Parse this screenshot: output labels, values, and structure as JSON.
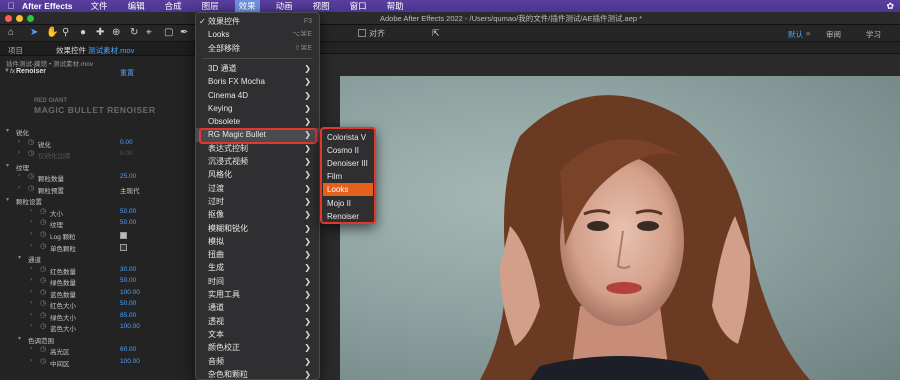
{
  "menubar": {
    "app_name": "After Effects",
    "items": [
      "文件",
      "编辑",
      "合成",
      "图层",
      "效果",
      "动画",
      "视图",
      "窗口",
      "帮助"
    ],
    "active_item": "效果"
  },
  "window": {
    "title": "Adobe After Effects 2022 - /Users/qumao/我的文件/插件测试/AE插件测试.aep *"
  },
  "toolbar": {
    "snap_label": "对齐",
    "workspaces": [
      "默认",
      "审阅",
      "学习"
    ],
    "current_workspace": "默认"
  },
  "left_panel": {
    "tab_project": "项目",
    "tab_effects_prefix": "效果控件",
    "tab_effects_clip": "测试素材.mov",
    "breadcrumb": "插件测试-藏馆 • 测试素材.mov",
    "effect_name": "Renoiser",
    "reset_label": "重置",
    "logo_line1": "RED GIANT",
    "logo_line2": "MAGIC BULLET RENOISER",
    "params": [
      {
        "name": "锐化",
        "level": 0,
        "value": ""
      },
      {
        "name": "锐化",
        "level": 1,
        "value": "0.00"
      },
      {
        "name": "仅锐化边缘",
        "level": 1,
        "value": "0.00",
        "dim": true
      },
      {
        "name": "纹理",
        "level": 0,
        "value": ""
      },
      {
        "name": "颗粒数量",
        "level": 1,
        "value": "25.00"
      },
      {
        "name": "颗粒预置",
        "level": 1,
        "value": "主现代",
        "text": true
      },
      {
        "name": "颗粒设置",
        "level": 0,
        "value": ""
      },
      {
        "name": "大小",
        "level": 2,
        "value": "50.00"
      },
      {
        "name": "纹理",
        "level": 2,
        "value": "50.00"
      },
      {
        "name": "Log 颗粒",
        "level": 2,
        "value": "",
        "checkbox": true,
        "checked": true
      },
      {
        "name": "单色颗粒",
        "level": 2,
        "value": "",
        "checkbox": true,
        "checked": false
      },
      {
        "name": "通道",
        "level": 1,
        "value": ""
      },
      {
        "name": "红色数量",
        "level": 2,
        "value": "30.00"
      },
      {
        "name": "绿色数量",
        "level": 2,
        "value": "50.00"
      },
      {
        "name": "蓝色数量",
        "level": 2,
        "value": "100.00"
      },
      {
        "name": "红色大小",
        "level": 2,
        "value": "50.00"
      },
      {
        "name": "绿色大小",
        "level": 2,
        "value": "85.00"
      },
      {
        "name": "蓝色大小",
        "level": 2,
        "value": "100.00"
      },
      {
        "name": "色调范围",
        "level": 1,
        "value": ""
      },
      {
        "name": "高光区",
        "level": 2,
        "value": "60.00"
      },
      {
        "name": "中间区",
        "level": 2,
        "value": "100.00"
      }
    ]
  },
  "effects_menu": {
    "items": [
      {
        "label": "效果控件",
        "shortcut": "F3",
        "checked": true
      },
      {
        "label": "Looks",
        "shortcut": "⌥⌘E"
      },
      {
        "label": "全部移除",
        "shortcut": "⇧⌘E"
      },
      {
        "sep": true
      },
      {
        "label": "3D 通道",
        "sub": true
      },
      {
        "label": "Boris FX Mocha",
        "sub": true
      },
      {
        "label": "Cinema 4D",
        "sub": true
      },
      {
        "label": "Keying",
        "sub": true
      },
      {
        "label": "Obsolete",
        "sub": true
      },
      {
        "label": "RG Magic Bullet",
        "sub": true,
        "highlight": true
      },
      {
        "label": "表达式控制",
        "sub": true
      },
      {
        "label": "沉浸式视频",
        "sub": true
      },
      {
        "label": "风格化",
        "sub": true
      },
      {
        "label": "过渡",
        "sub": true
      },
      {
        "label": "过时",
        "sub": true
      },
      {
        "label": "抠像",
        "sub": true
      },
      {
        "label": "模糊和锐化",
        "sub": true
      },
      {
        "label": "模拟",
        "sub": true
      },
      {
        "label": "扭曲",
        "sub": true
      },
      {
        "label": "生成",
        "sub": true
      },
      {
        "label": "时间",
        "sub": true
      },
      {
        "label": "实用工具",
        "sub": true
      },
      {
        "label": "通道",
        "sub": true
      },
      {
        "label": "透视",
        "sub": true
      },
      {
        "label": "文本",
        "sub": true
      },
      {
        "label": "颜色校正",
        "sub": true
      },
      {
        "label": "音频",
        "sub": true
      },
      {
        "label": "杂色和颗粒",
        "sub": true
      }
    ]
  },
  "submenu": {
    "items": [
      "Colorista V",
      "Cosmo II",
      "Denoiser III",
      "Film",
      "Looks",
      "Mojo II",
      "Renoiser"
    ],
    "active": "Looks"
  },
  "colors": {
    "accent_blue": "#4fa3ff",
    "highlight_red": "#e0382b",
    "submenu_active": "#e2621c"
  }
}
